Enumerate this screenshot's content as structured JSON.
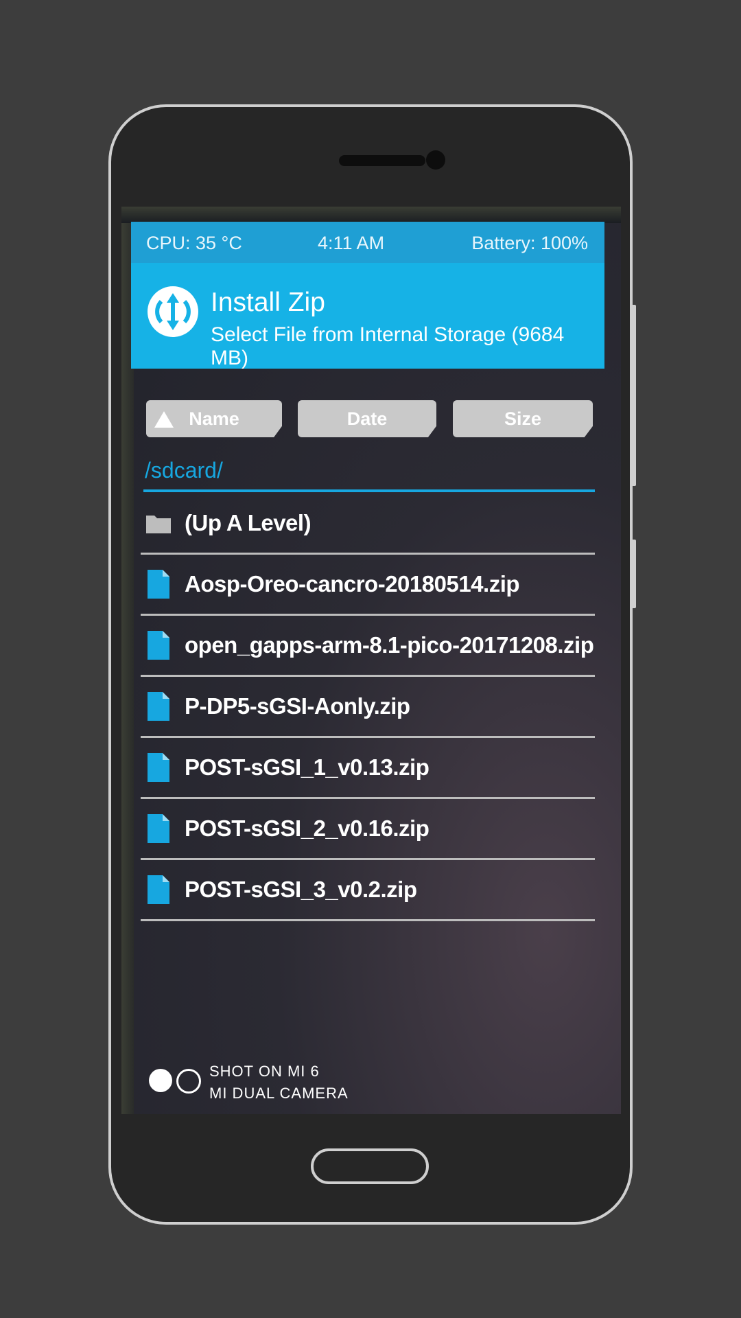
{
  "status_bar": {
    "cpu": "CPU: 35 °C",
    "time": "4:11 AM",
    "battery": "Battery: 100%"
  },
  "header": {
    "logo_icon": "twrp-logo-icon",
    "title": "Install Zip",
    "subtitle": "Select File from Internal Storage (9684 MB)"
  },
  "sort_buttons": {
    "name": "Name",
    "date": "Date",
    "size": "Size",
    "active_indicator": "triangle-up-icon"
  },
  "current_path": "/sdcard/",
  "files": [
    {
      "label": "(Up A Level)",
      "icon": "folder-icon"
    },
    {
      "label": "Aosp-Oreo-cancro-20180514.zip",
      "icon": "file-icon"
    },
    {
      "label": "open_gapps-arm-8.1-pico-20171208.zip",
      "icon": "file-icon"
    },
    {
      "label": "P-DP5-sGSI-Aonly.zip",
      "icon": "file-icon"
    },
    {
      "label": "POST-sGSI_1_v0.13.zip",
      "icon": "file-icon"
    },
    {
      "label": "POST-sGSI_2_v0.16.zip",
      "icon": "file-icon"
    },
    {
      "label": "POST-sGSI_3_v0.2.zip",
      "icon": "file-icon"
    }
  ],
  "watermark": {
    "line1": "SHOT ON MI 6",
    "line2": "MI DUAL CAMERA"
  },
  "colors": {
    "accent": "#16b2e6",
    "status_bar": "#1f9fd4",
    "background": "#3d3d3d",
    "phone_body": "#262626"
  }
}
